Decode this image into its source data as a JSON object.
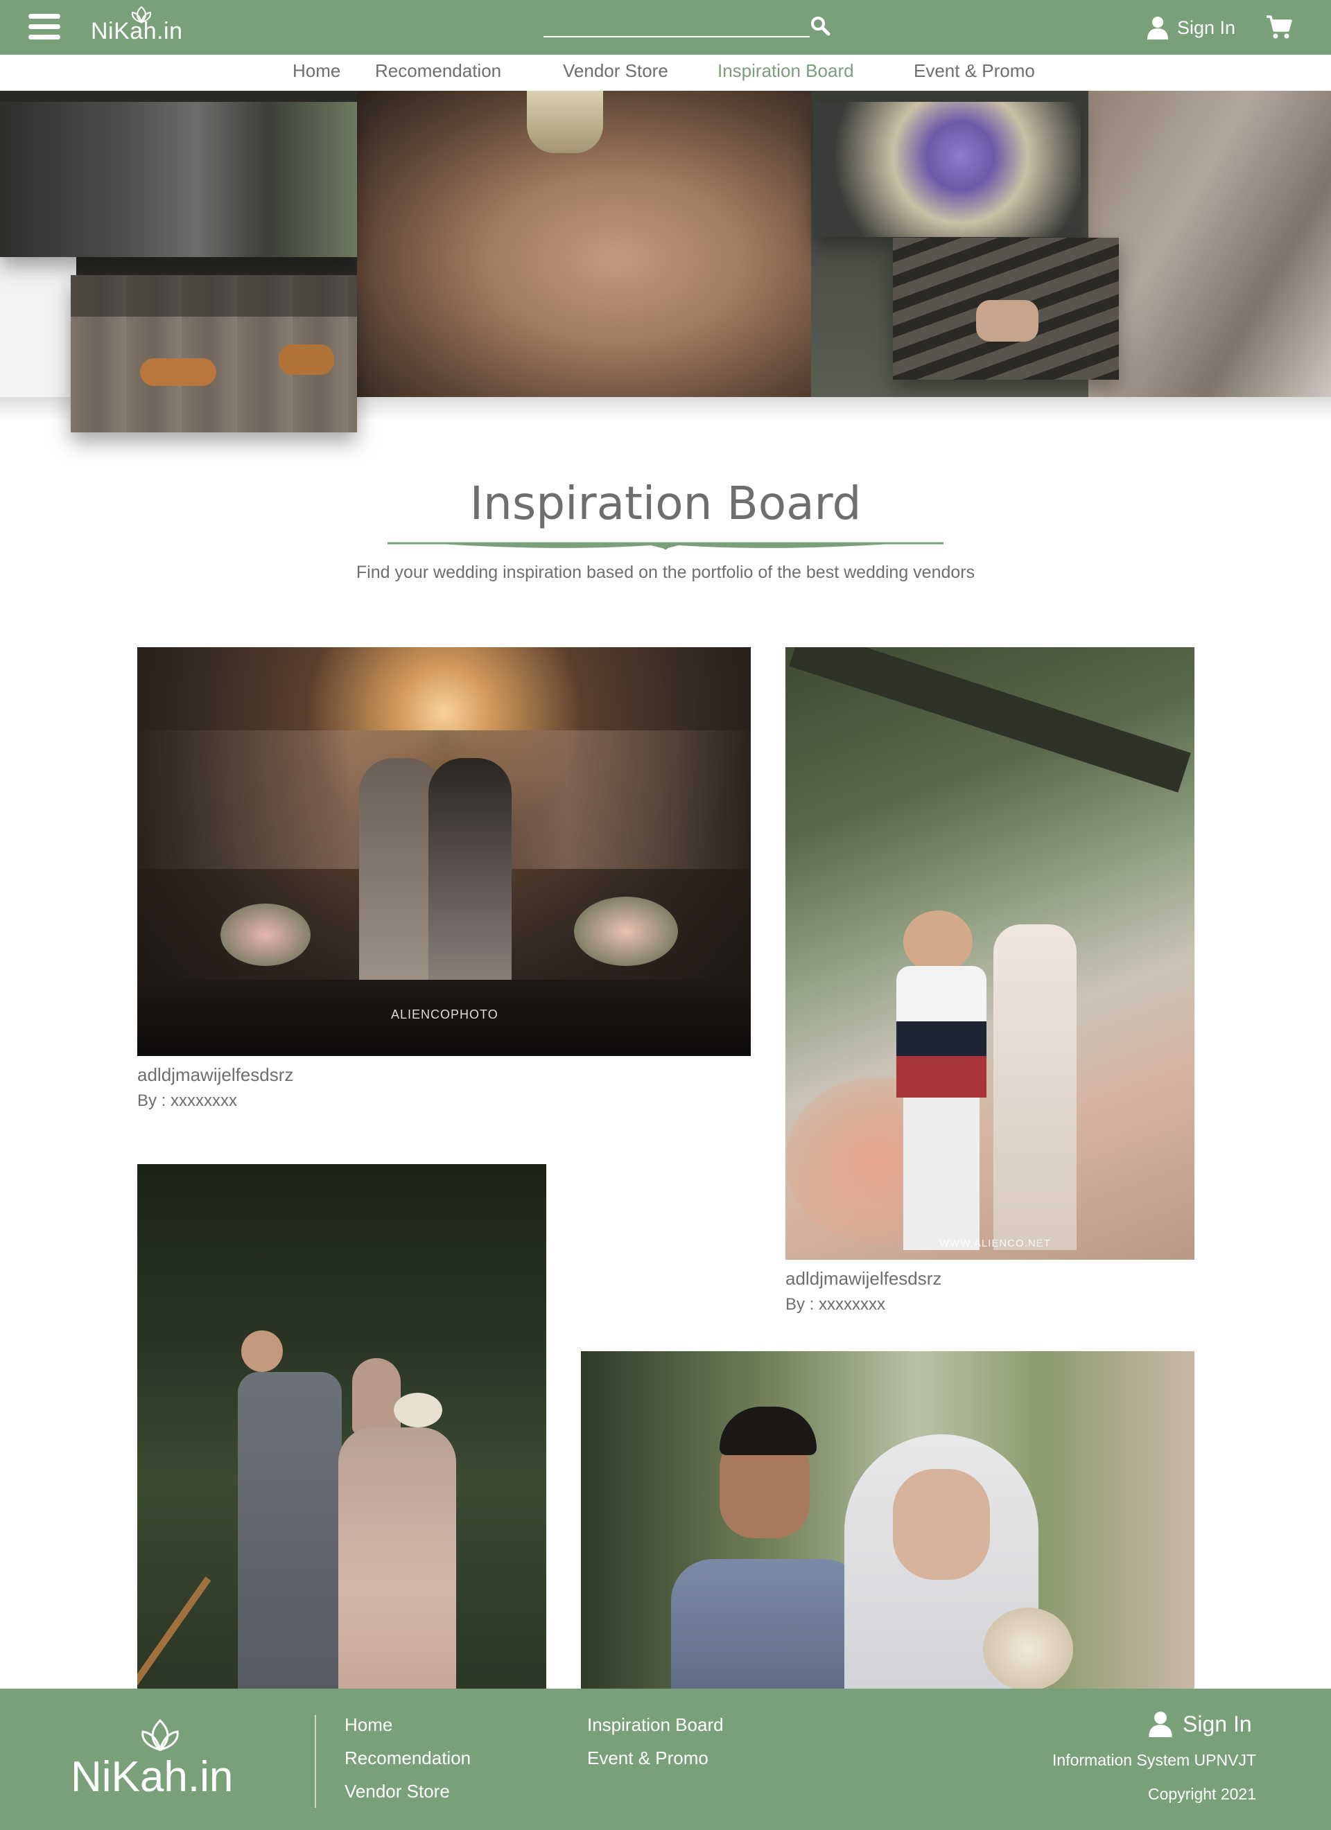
{
  "header": {
    "brand": "NiKah.in",
    "search_placeholder": "",
    "signin_label": "Sign In",
    "menu_icon": "hamburger-menu-icon",
    "search_icon": "search-icon",
    "user_icon": "user-icon",
    "cart_icon": "cart-icon"
  },
  "nav": {
    "items": [
      {
        "label": "Home",
        "active": false
      },
      {
        "label": "Recomendation",
        "active": false
      },
      {
        "label": "Vendor Store",
        "active": false
      },
      {
        "label": "Inspiration Board",
        "active": true
      },
      {
        "label": "Event & Promo",
        "active": false
      }
    ]
  },
  "page": {
    "title": "Inspiration Board",
    "subtitle": "Find your wedding inspiration based on the portfolio of the best wedding vendors"
  },
  "cards": [
    {
      "caption": "adldjmawijelfesdsrz",
      "author": "By : xxxxxxxx",
      "watermark": "ALIENCOPHOTO"
    },
    {
      "caption": "adldjmawijelfesdsrz",
      "author": "By : xxxxxxxx",
      "watermark": "WWW.ALIENCO.NET"
    },
    {
      "caption": "",
      "author": "",
      "watermark": ""
    },
    {
      "caption": "",
      "author": "",
      "watermark": ""
    }
  ],
  "footer": {
    "brand": "NiKah.in",
    "links_col1": [
      "Home",
      "Recomendation",
      "Vendor Store"
    ],
    "links_col2": [
      "Inspiration Board",
      "Event & Promo"
    ],
    "signin_label": "Sign In",
    "info": "Information System UPNVJT",
    "copyright": "Copyright 2021"
  },
  "colors": {
    "brand_green": "#7aa07a",
    "text_gray": "#6e6e6e"
  }
}
